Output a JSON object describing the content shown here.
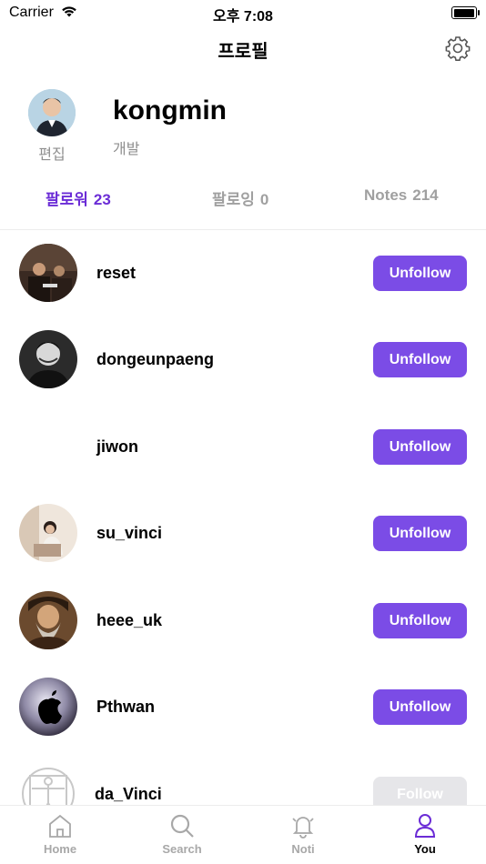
{
  "status_bar": {
    "carrier": "Carrier",
    "time": "오후 7:08"
  },
  "header": {
    "title": "프로필"
  },
  "profile": {
    "edit_label": "편집",
    "username": "kongmin",
    "role": "개발"
  },
  "tabs": [
    {
      "label": "팔로워",
      "count": "23",
      "active": true
    },
    {
      "label": "팔로잉",
      "count": "0",
      "active": false
    },
    {
      "label": "Notes",
      "count": "214",
      "active": false
    }
  ],
  "followers": [
    {
      "name": "reset",
      "button": "Unfollow"
    },
    {
      "name": "dongeunpaeng",
      "button": "Unfollow"
    },
    {
      "name": "jiwon",
      "button": "Unfollow"
    },
    {
      "name": "su_vinci",
      "button": "Unfollow"
    },
    {
      "name": "heee_uk",
      "button": "Unfollow"
    },
    {
      "name": "Pthwan",
      "button": "Unfollow"
    },
    {
      "name": "da_Vinci",
      "button": "Follow"
    }
  ],
  "tab_bar": [
    {
      "label": "Home",
      "icon": "home-icon"
    },
    {
      "label": "Search",
      "icon": "search-icon"
    },
    {
      "label": "Noti",
      "icon": "bell-icon"
    },
    {
      "label": "You",
      "icon": "person-icon",
      "active": true
    }
  ],
  "colors": {
    "accent": "#7b4ce6",
    "active_tab": "#6b2cd6",
    "muted": "#a0a0a0",
    "follow_disabled": "#e6e6e9"
  }
}
